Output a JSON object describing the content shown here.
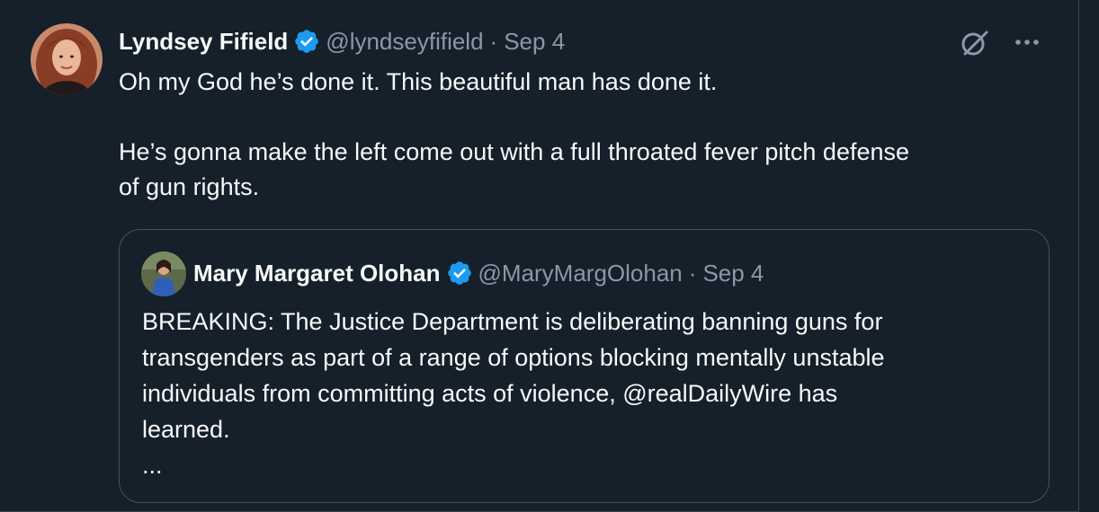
{
  "tweet": {
    "author": {
      "display_name": "Lyndsey Fifield",
      "handle": "@lyndseyfifield",
      "verified": true
    },
    "separator": "·",
    "timestamp": "Sep 4",
    "text": "Oh my God he’s done it. This beautiful man has done it.\n\nHe’s gonna make the left come out with a full throated fever pitch defense\nof gun rights.",
    "icons": {
      "verified": "verified-badge-icon",
      "grok": "grok-icon",
      "more": "more-options-icon"
    }
  },
  "quoted_tweet": {
    "author": {
      "display_name": "Mary Margaret Olohan",
      "handle": "@MaryMargOlohan",
      "verified": true
    },
    "separator": "·",
    "timestamp": "Sep 4",
    "text": "BREAKING: The Justice Department is deliberating banning guns for\ntransgenders as part of a range of options blocking mentally unstable\nindividuals from committing acts of violence, @realDailyWire has\nlearned.\n..."
  },
  "colors": {
    "background": "#15202b",
    "primary_text": "#f7f9f9",
    "secondary_text": "#8b98a5",
    "verified_blue": "#1d9bf0",
    "border": "#38444d"
  }
}
